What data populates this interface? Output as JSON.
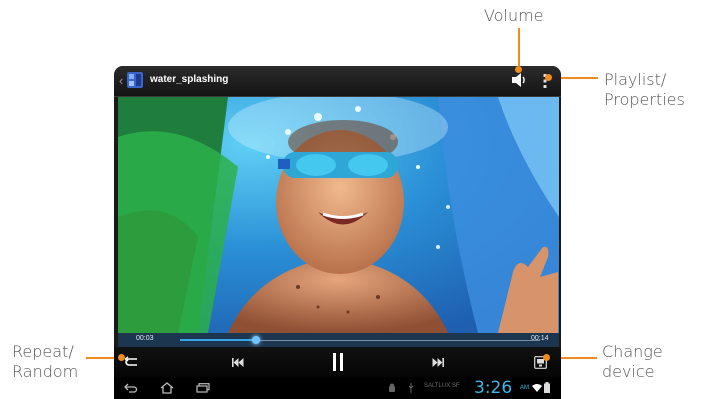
{
  "callouts": {
    "volume": "Volume",
    "playlist_line1": "Playlist/",
    "playlist_line2": "Properties",
    "repeat_line1": "Repeat/",
    "repeat_line2": "Random",
    "change_line1": "Change",
    "change_line2": "device"
  },
  "titlebar": {
    "back_glyph": "‹",
    "title": "water_splashing",
    "volume_icon": "speaker-icon",
    "menu_icon": "overflow-menu-icon"
  },
  "progress": {
    "elapsed": "00:03",
    "total": "00:14",
    "fraction": 0.21
  },
  "controls": {
    "repeat_icon": "repeat-icon",
    "previous_icon": "previous-icon",
    "pause_icon": "pause-icon",
    "next_icon": "next-icon",
    "change_device_icon": "change-device-icon"
  },
  "statusbar": {
    "carrier": "SALTLUX SF",
    "time": "3:26",
    "ampm": "AM"
  },
  "colors": {
    "accent_orange": "#f28c1e",
    "progress_blue": "#37a7e8",
    "clock_blue": "#3db7ea"
  }
}
